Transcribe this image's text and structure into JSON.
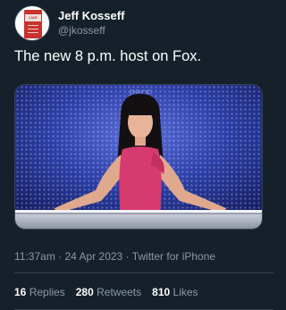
{
  "author": {
    "name": "Jeff Kosseff",
    "handle": "@jkosseff",
    "avatar_text": "LIAR"
  },
  "tweet": {
    "text": "The new 8 p.m. host on Fox."
  },
  "media": {
    "backdrop_text": "PROF",
    "description_icon": "news-anchor-photo"
  },
  "meta": {
    "time": "11:37am",
    "date": "24 Apr 2023",
    "source": "Twitter for iPhone",
    "separator": "·"
  },
  "stats": [
    {
      "count": "16",
      "label": "Replies"
    },
    {
      "count": "280",
      "label": "Retweets"
    },
    {
      "count": "810",
      "label": "Likes"
    }
  ],
  "colors": {
    "background": "#15202b",
    "secondary_text": "#8b98a5",
    "divider": "#38444d"
  }
}
